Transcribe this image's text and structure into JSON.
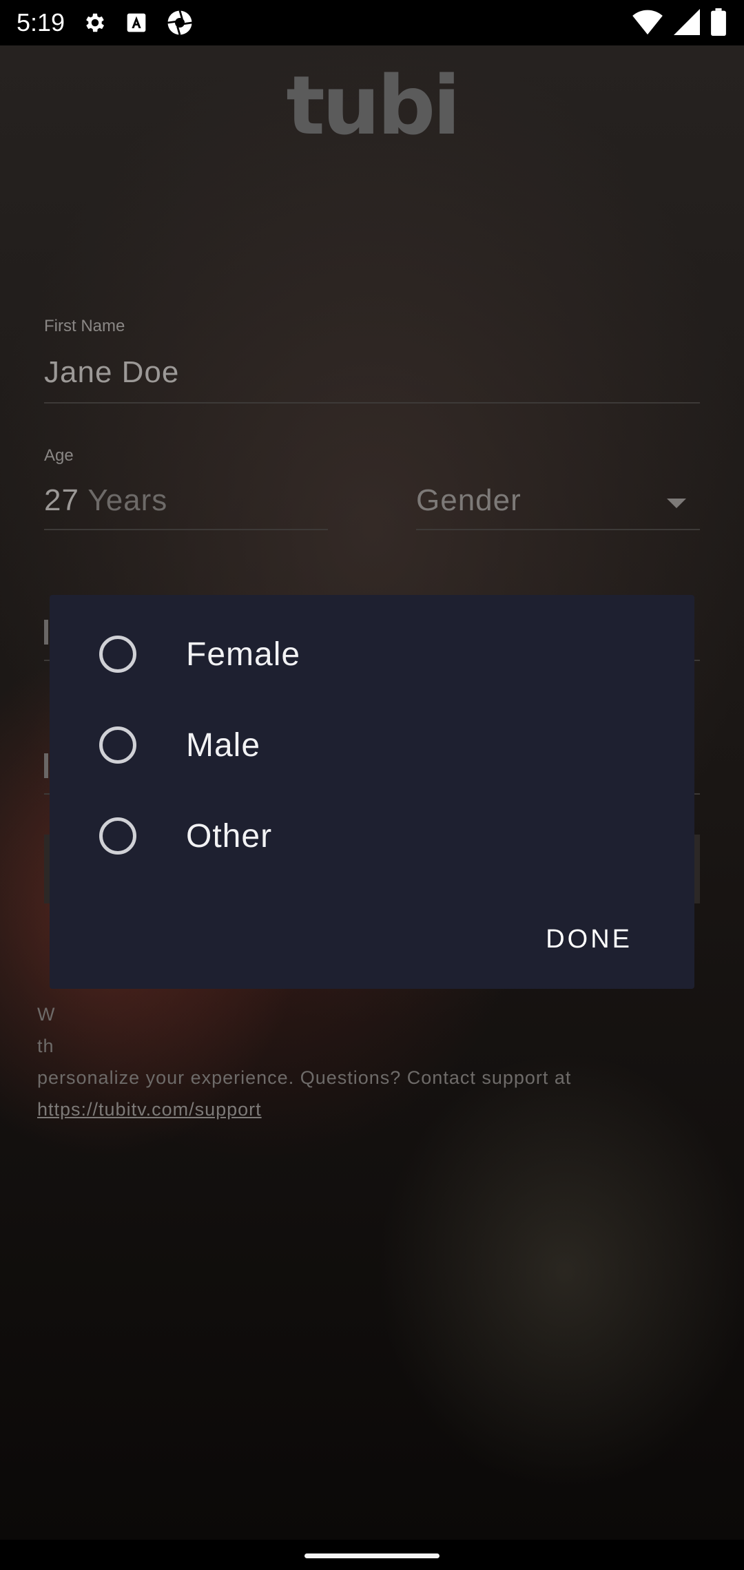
{
  "status_bar": {
    "time": "5:19",
    "left_icons": [
      "gear-icon",
      "font-a-icon",
      "camera-shutter-icon"
    ],
    "right_icons": [
      "wifi-icon",
      "cellular-signal-icon",
      "battery-icon"
    ]
  },
  "app": {
    "logo": "tubi",
    "first_name": {
      "label": "First Name",
      "value": "Jane Doe"
    },
    "age": {
      "label": "Age",
      "value": "27",
      "unit": "Years"
    },
    "gender": {
      "placeholder": "Gender"
    },
    "footer": {
      "text_fragment_1": "W",
      "text_fragment_2": "th",
      "text_line": "personalize your experience. Questions? Contact support at",
      "link": "https://tubitv.com/support"
    }
  },
  "dialog": {
    "options": [
      {
        "label": "Female",
        "selected": false
      },
      {
        "label": "Male",
        "selected": false
      },
      {
        "label": "Other",
        "selected": false
      }
    ],
    "done_label": "DONE"
  }
}
